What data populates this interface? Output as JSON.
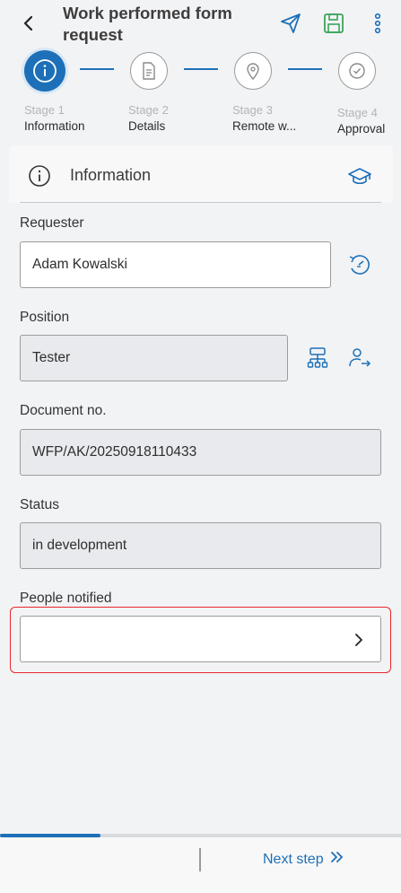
{
  "header": {
    "title": "Work performed form request",
    "icons": [
      "back-arrow-icon",
      "send-icon",
      "save-icon",
      "more-vertical-icon"
    ]
  },
  "stepper": {
    "steps": [
      {
        "stage": "Stage 1",
        "name": "Information",
        "icon": "info-icon",
        "active": true
      },
      {
        "stage": "Stage 2",
        "name": "Details",
        "icon": "document-icon",
        "active": false
      },
      {
        "stage": "Stage 3",
        "name": "Remote w...",
        "icon": "location-pin-icon",
        "active": false
      },
      {
        "stage": "Stage 4",
        "name": "Approval",
        "icon": "check-circle-icon",
        "active": false
      }
    ]
  },
  "section": {
    "title": "Information",
    "icon": "info-icon",
    "action_icon": "graduation-cap-icon"
  },
  "fields": {
    "requester": {
      "label": "Requester",
      "value": "Adam Kowalski"
    },
    "position": {
      "label": "Position",
      "value": "Tester"
    },
    "document_no": {
      "label": "Document no.",
      "value": "WFP/AK/20250918110433"
    },
    "status": {
      "label": "Status",
      "value": "in development"
    },
    "people_notified": {
      "label": "People notified",
      "value": ""
    }
  },
  "footer": {
    "next_label": "Next step",
    "progress": 0.25
  },
  "colors": {
    "accent": "#1d70b8",
    "save": "#3aa45a",
    "highlight": "#e8262d"
  }
}
